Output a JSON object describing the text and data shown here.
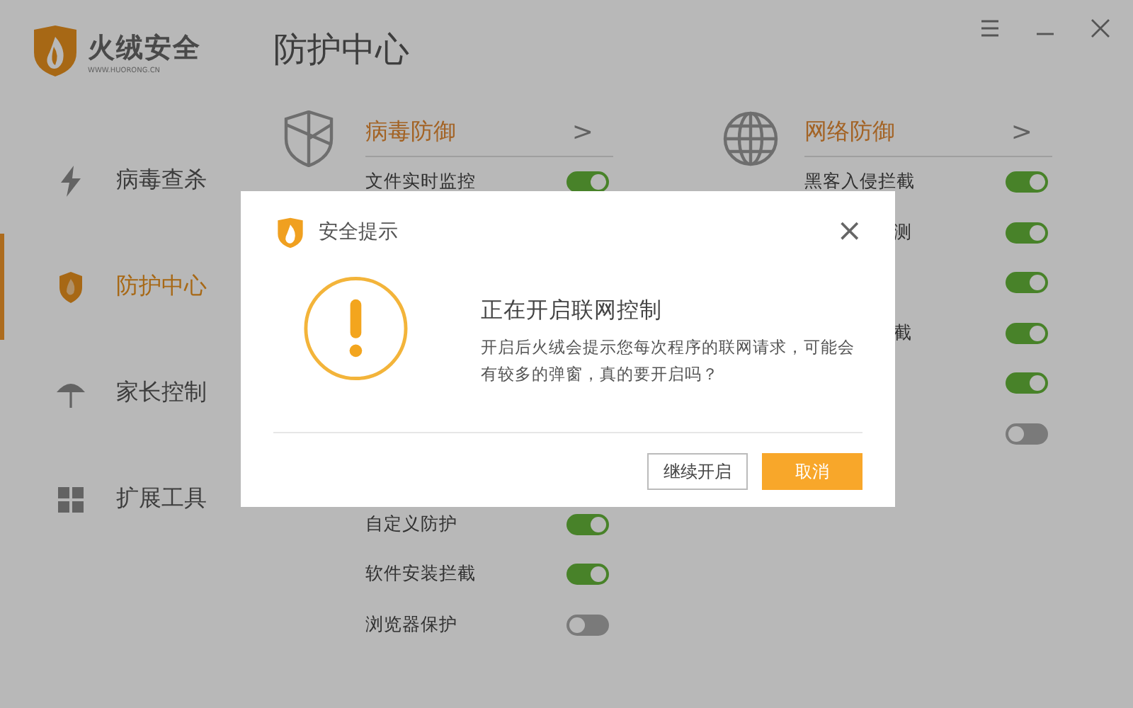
{
  "app": {
    "name": "火绒安全",
    "site": "WWW.HUORONG.CN"
  },
  "window_controls": [
    {
      "kind": "menu"
    },
    {
      "kind": "minimize"
    },
    {
      "kind": "close"
    }
  ],
  "sidebar": {
    "items": [
      {
        "label": "病毒查杀",
        "kind": "bolt",
        "selected": false
      },
      {
        "label": "防护中心",
        "kind": "shield",
        "selected": true
      },
      {
        "label": "家长控制",
        "kind": "umbrella",
        "selected": false
      },
      {
        "label": "扩展工具",
        "kind": "grid",
        "selected": false
      }
    ]
  },
  "page_title": "防护中心",
  "sections": [
    {
      "title": "病毒防御",
      "kind": "shield",
      "chevron": ">",
      "rows": [
        {
          "label": "文件实时监控",
          "on": true
        },
        {
          "label": "自定义防护",
          "on": true
        },
        {
          "label": "软件安装拦截",
          "on": true
        },
        {
          "label": "浏览器保护",
          "on": false
        }
      ]
    },
    {
      "title": "网络防御",
      "kind": "globe",
      "chevron": ">",
      "rows": [
        {
          "label": "黑客入侵拦截",
          "on": true
        },
        {
          "label": "测",
          "on": true
        },
        {
          "on": true
        },
        {
          "label": "截",
          "on": true
        },
        {
          "on": true
        },
        {
          "on": false
        }
      ]
    }
  ],
  "dialog": {
    "title": "安全提示",
    "close": "×",
    "heading": "正在开启联网控制",
    "message": "开启后火绒会提示您每次程序的联网请求，可能会有较多的弹窗，真的要开启吗？",
    "buttons": [
      {
        "label": "继续开启",
        "kind": "secondary"
      },
      {
        "label": "取消",
        "kind": "primary"
      }
    ]
  }
}
